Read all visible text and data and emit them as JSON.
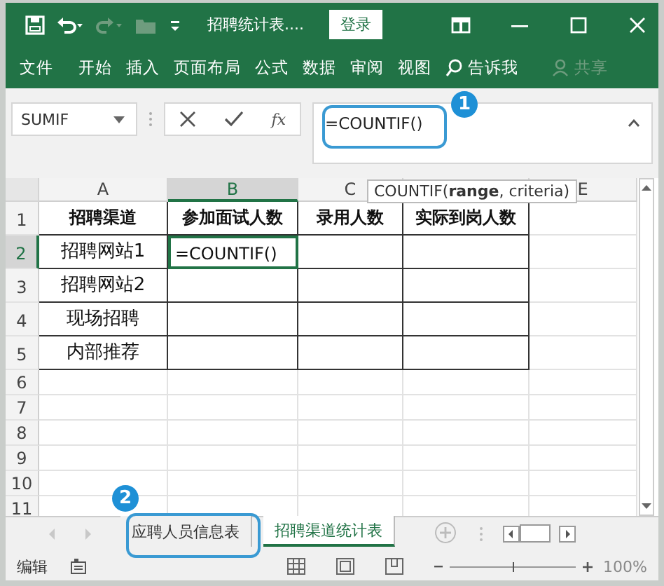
{
  "window": {
    "title": "招聘统计表....",
    "login_button": "登录"
  },
  "ribbon_tabs": [
    {
      "label": "文件"
    },
    {
      "label": "开始"
    },
    {
      "label": "插入"
    },
    {
      "label": "页面布局"
    },
    {
      "label": "公式"
    },
    {
      "label": "数据"
    },
    {
      "label": "审阅"
    },
    {
      "label": "视图"
    }
  ],
  "tell_me": "告诉我",
  "share": "共享",
  "formula_bar": {
    "name_box": "SUMIF",
    "fx": "fx",
    "formula": "=COUNTIF()"
  },
  "tooltip": "COUNTIF(**range**, criteria)",
  "columns": [
    {
      "label": "A",
      "selected": false
    },
    {
      "label": "B",
      "selected": true
    },
    {
      "label": "C",
      "selected": false
    },
    {
      "selected": false
    },
    {
      "label": "E",
      "selected": false
    }
  ],
  "rows": [
    {
      "header": "1",
      "selected": false,
      "kind": "header",
      "cells": [
        "招聘渠道",
        "参加面试人数",
        "录用人数",
        "实际到岗人数"
      ]
    },
    {
      "header": "2",
      "selected": true,
      "kind": "data",
      "cells": [
        "招聘网站1",
        "=COUNTIF()"
      ]
    },
    {
      "header": "3",
      "selected": false,
      "kind": "data",
      "cells": [
        "招聘网站2"
      ]
    },
    {
      "header": "4",
      "selected": false,
      "kind": "data",
      "cells": [
        "现场招聘"
      ]
    },
    {
      "header": "5",
      "selected": false,
      "kind": "data",
      "cells": [
        "内部推荐"
      ]
    },
    {
      "header": "6",
      "selected": false,
      "kind": "blank"
    },
    {
      "header": "7",
      "selected": false,
      "kind": "blank"
    },
    {
      "header": "8",
      "selected": false,
      "kind": "blank"
    },
    {
      "header": "9",
      "selected": false,
      "kind": "blank"
    },
    {
      "header": "10",
      "selected": false,
      "kind": "blank"
    },
    {
      "header": "11",
      "selected": false,
      "kind": "blank"
    }
  ],
  "sheet_tabs": [
    {
      "label": "应聘人员信息表",
      "selected": false
    },
    {
      "label": "招聘渠道统计表",
      "selected": true
    }
  ],
  "status_bar": {
    "mode": "编辑",
    "zoom": "100%",
    "zoom_level": {
      "level": 0.5
    }
  },
  "callouts": [
    {
      "number": "1"
    },
    {
      "number": "2"
    }
  ]
}
